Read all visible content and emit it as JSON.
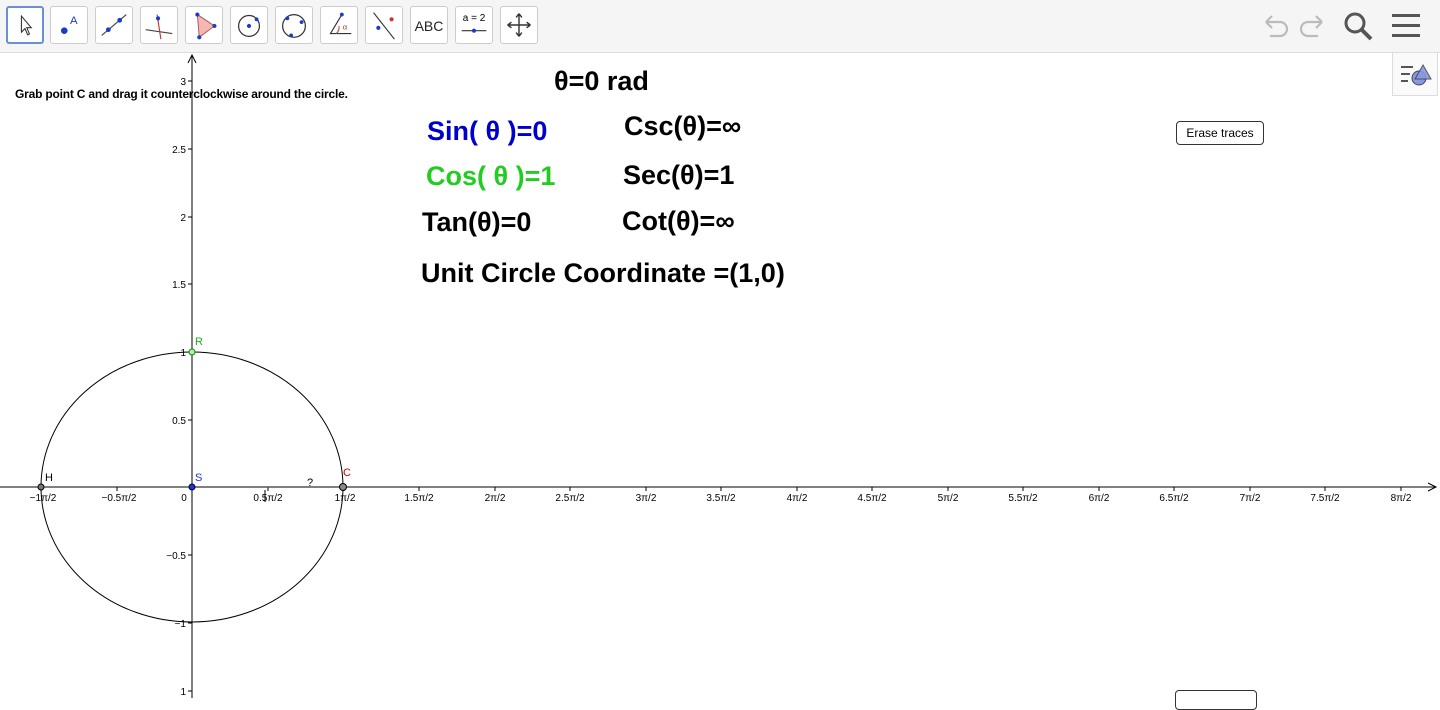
{
  "toolbar": {
    "tools": [
      {
        "name": "move-tool-icon"
      },
      {
        "name": "point-tool-icon"
      },
      {
        "name": "line-tool-icon"
      },
      {
        "name": "perpendicular-tool-icon"
      },
      {
        "name": "polygon-tool-icon"
      },
      {
        "name": "circle-tool-icon"
      },
      {
        "name": "circle-three-points-tool-icon"
      },
      {
        "name": "angle-tool-icon"
      },
      {
        "name": "reflect-tool-icon"
      },
      {
        "name": "text-tool-icon",
        "label": "ABC"
      },
      {
        "name": "slider-tool-icon",
        "label": "a = 2"
      },
      {
        "name": "move-graphics-tool-icon"
      }
    ]
  },
  "canvas": {
    "instruction": "Grab point C and drag it counterclockwise around the circle.",
    "theta": "θ=0 rad",
    "sin": "Sin( θ )=0",
    "cos": "Cos( θ )=1",
    "tan": "Tan(θ)=0",
    "csc": "Csc(θ)=∞",
    "sec": "Sec(θ)=1",
    "cot": "Cot(θ)=∞",
    "coordinate": "Unit Circle Coordinate =(1,0)",
    "erase_label": "Erase traces",
    "point_labels": {
      "R": "R",
      "H": "H",
      "S": "S",
      "C": "C",
      "q": "?"
    },
    "y_ticks": [
      "3",
      "2.5",
      "2",
      "1.5",
      "1",
      "0.5",
      "−0.5",
      "−1",
      "1"
    ],
    "x_ticks": [
      "−1π/2",
      "−0.5π/2",
      "0",
      "0.5π/2",
      "1π/2",
      "1.5π/2",
      "2π/2",
      "2.5π/2",
      "3π/2",
      "3.5π/2",
      "4π/2",
      "4.5π/2",
      "5π/2",
      "5.5π/2",
      "6π/2",
      "6.5π/2",
      "7π/2",
      "7.5π/2",
      "8π/2"
    ]
  },
  "colors": {
    "sin": "#0000cc",
    "cos": "#22cc22",
    "text": "#000000",
    "point_c": "#cc0000"
  }
}
